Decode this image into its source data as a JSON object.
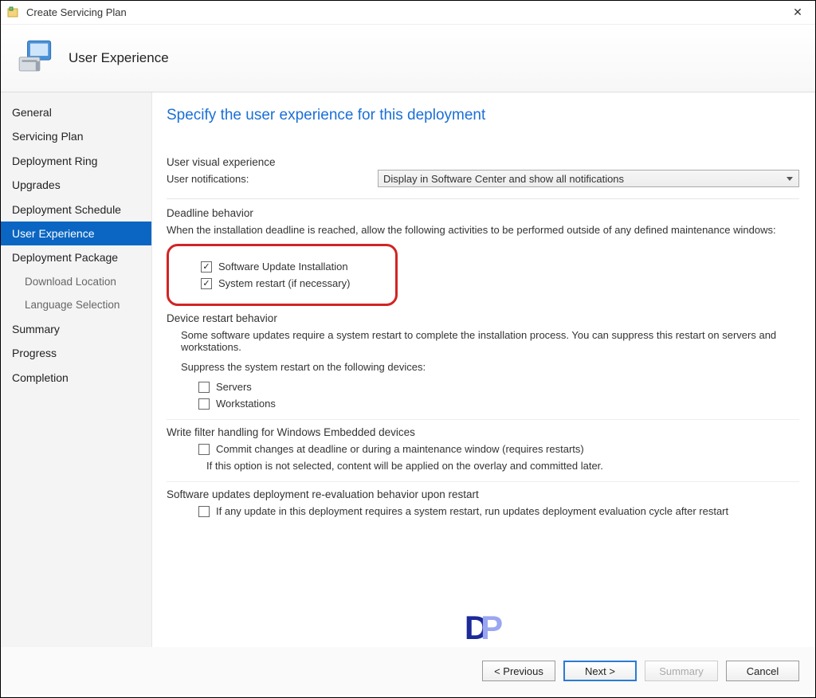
{
  "window": {
    "title": "Create Servicing Plan",
    "close": "✕"
  },
  "banner": {
    "title": "User Experience"
  },
  "sidebar": {
    "items": [
      {
        "label": "General",
        "sub": false
      },
      {
        "label": "Servicing Plan",
        "sub": false
      },
      {
        "label": "Deployment Ring",
        "sub": false
      },
      {
        "label": "Upgrades",
        "sub": false
      },
      {
        "label": "Deployment Schedule",
        "sub": false
      },
      {
        "label": "User Experience",
        "sub": false,
        "selected": true
      },
      {
        "label": "Deployment Package",
        "sub": false
      },
      {
        "label": "Download Location",
        "sub": true
      },
      {
        "label": "Language Selection",
        "sub": true
      },
      {
        "label": "Summary",
        "sub": false
      },
      {
        "label": "Progress",
        "sub": false
      },
      {
        "label": "Completion",
        "sub": false
      }
    ]
  },
  "main": {
    "heading": "Specify the user experience for this deployment",
    "visual": {
      "group": "User visual experience",
      "label": "User notifications:",
      "value": "Display in Software Center and show all notifications"
    },
    "deadline": {
      "title": "Deadline behavior",
      "desc": "When the installation deadline is reached, allow the following activities to be performed outside of any defined maintenance windows:",
      "checks": [
        {
          "label": "Software Update Installation",
          "checked": true
        },
        {
          "label": "System restart (if necessary)",
          "checked": true
        }
      ]
    },
    "restart": {
      "title": "Device restart behavior",
      "desc": "Some software updates require a system restart to complete the installation process. You can suppress this restart on servers and workstations.",
      "desc2": "Suppress the system restart on the following devices:",
      "checks": [
        {
          "label": "Servers",
          "checked": false
        },
        {
          "label": "Workstations",
          "checked": false
        }
      ]
    },
    "writefilter": {
      "title": "Write filter handling for Windows Embedded devices",
      "check": {
        "label": "Commit changes at deadline or during a maintenance window (requires restarts)",
        "checked": false
      },
      "note": "If this option is not selected, content will be applied on the overlay and committed later."
    },
    "reeval": {
      "title": "Software updates deployment re-evaluation behavior upon restart",
      "check": {
        "label": "If any update in this deployment requires a system restart, run updates deployment evaluation cycle after restart",
        "checked": false
      }
    }
  },
  "footer": {
    "previous": "< Previous",
    "next": "Next >",
    "summary": "Summary",
    "cancel": "Cancel"
  }
}
